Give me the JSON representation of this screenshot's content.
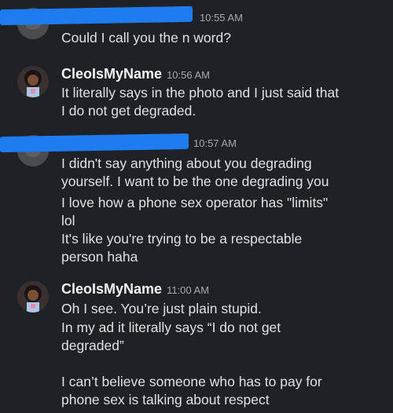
{
  "messages": [
    {
      "username": "",
      "time": "10:55 AM",
      "lines": [
        "Could I call you the n word?"
      ]
    },
    {
      "username": "CleoIsMyName",
      "time": "10:56 AM",
      "lines": [
        "It literally says in the photo and I just said that",
        "I do not get degraded."
      ]
    },
    {
      "username": "",
      "time": "10:57 AM",
      "lines": [
        "I didn't say anything about you degrading",
        "yourself. I want to be the one degrading you",
        "I love how a phone sex operator has \"limits\"",
        "lol",
        "It's like you're trying to be a respectable",
        "person haha"
      ]
    },
    {
      "username": "CleoIsMyName",
      "time": "11:00 AM",
      "lines": [
        "Oh I see. You’re just plain stupid.",
        "In my ad it literally says “I do not get",
        "degraded”",
        "",
        "I can’t believe someone who has to pay for",
        "phone sex is talking about respect"
      ]
    }
  ],
  "icons": {
    "other_user_avatar": "avatar-icon",
    "cleo_avatar": "cartoon-avatar-icon",
    "redaction": "redaction-scribble"
  },
  "colors": {
    "background": "#1e2125",
    "redaction": "#1e7cf0"
  }
}
